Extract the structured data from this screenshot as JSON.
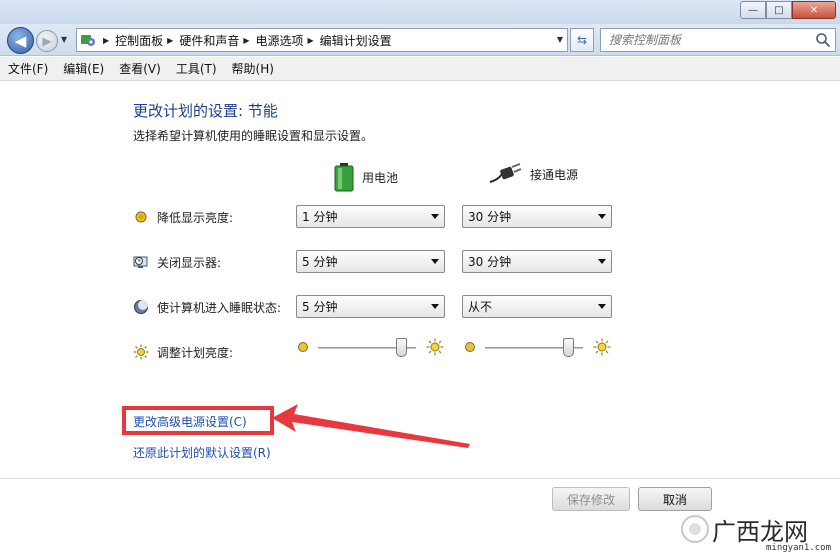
{
  "window": {
    "minimize": "—",
    "maximize": "□",
    "close": "✕"
  },
  "nav": {
    "breadcrumbs": [
      "控制面板",
      "硬件和声音",
      "电源选项",
      "编辑计划设置"
    ],
    "search_placeholder": "搜索控制面板"
  },
  "menu": [
    "文件(F)",
    "编辑(E)",
    "查看(V)",
    "工具(T)",
    "帮助(H)"
  ],
  "page": {
    "title": "更改计划的设置: 节能",
    "subtitle": "选择希望计算机使用的睡眠设置和显示设置。",
    "battery_label": "用电池",
    "plugged_label": "接通电源"
  },
  "settings": [
    {
      "label": "降低显示亮度:",
      "battery": "1 分钟",
      "plugged": "30 分钟"
    },
    {
      "label": "关闭显示器:",
      "battery": "5 分钟",
      "plugged": "30 分钟"
    },
    {
      "label": "使计算机进入睡眠状态:",
      "battery": "5 分钟",
      "plugged": "从不"
    }
  ],
  "brightness": {
    "label": "调整计划亮度:",
    "battery_level": 0.85,
    "plugged_level": 0.85
  },
  "links": {
    "advanced": "更改高级电源设置(C)",
    "restore": "还原此计划的默认设置(R)"
  },
  "buttons": {
    "save": "保存修改",
    "cancel": "取消"
  },
  "watermark": {
    "text": "广西龙网",
    "url": "mingyan1.com"
  },
  "colors": {
    "title": "#1f3f8c",
    "link": "#1f4fb0",
    "highlight": "#e8383d"
  }
}
